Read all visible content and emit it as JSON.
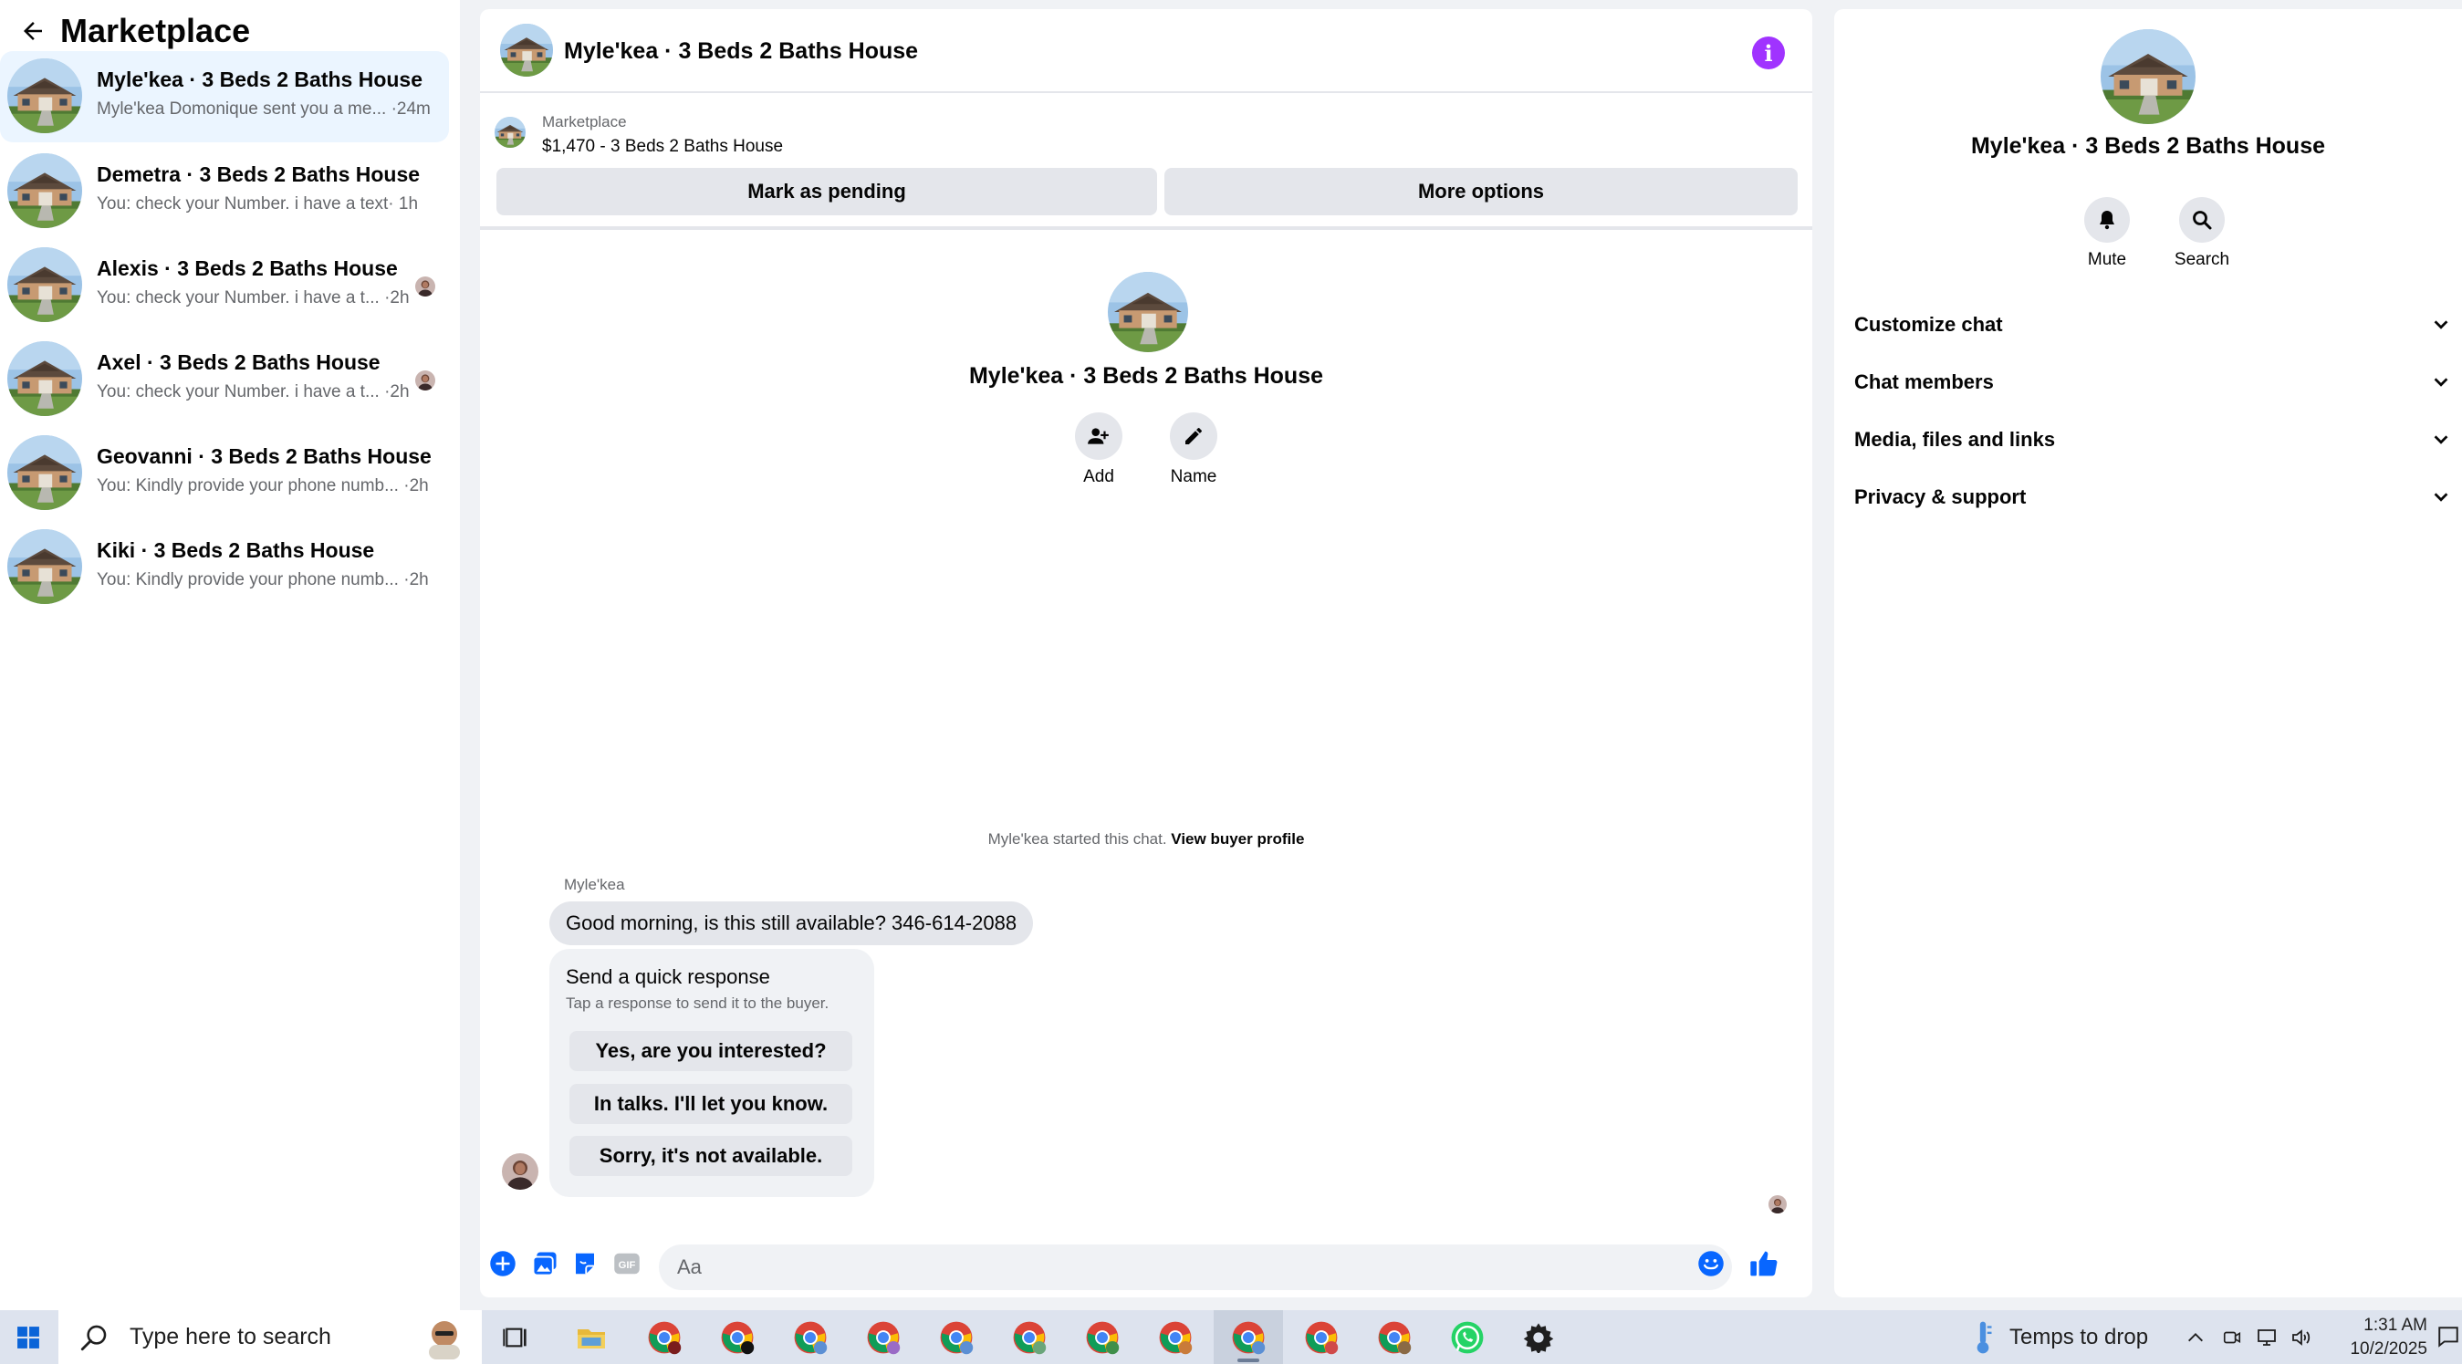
{
  "colors": {
    "accent": "#0866ff",
    "info_button": "#a033ff",
    "active_conversation": "#ebf5ff",
    "secondary_text": "#65676b",
    "button_bg": "#e4e6eb"
  },
  "sidebar": {
    "title": "Marketplace",
    "back_icon": "arrow-left-icon",
    "conversations": [
      {
        "name": "Myle'kea · 3 Beds 2 Baths House",
        "snippet": "Myle'kea Domonique sent you a me... ·24m",
        "active": true
      },
      {
        "name": "Demetra · 3 Beds 2 Baths House",
        "snippet": "You: check your Number. i have a text· 1h",
        "active": false
      },
      {
        "name": "Alexis · 3 Beds 2 Baths House",
        "snippet": "You: check your Number. i have a t... ·2h",
        "active": false
      },
      {
        "name": "Axel · 3 Beds 2 Baths House",
        "snippet": "You: check your Number. i have a t... ·2h",
        "active": false
      },
      {
        "name": "Geovanni · 3 Beds 2 Baths House",
        "snippet": "You: Kindly provide your phone numb... ·2h",
        "active": false
      },
      {
        "name": "Kiki · 3 Beds 2 Baths House",
        "snippet": "You: Kindly provide your phone numb... ·2h",
        "active": false
      }
    ]
  },
  "chat": {
    "title": "Myle'kea · 3 Beds 2 Baths House",
    "info_icon": "info-icon",
    "marketplace_label": "Marketplace",
    "listing": "$1,470 - 3 Beds 2 Baths House",
    "mark_pending_label": "Mark as pending",
    "more_options_label": "More options",
    "intro_title": "Myle'kea · 3 Beds 2 Baths House",
    "add_label": "Add",
    "name_label": "Name",
    "started_text": "Myle'kea started this chat.",
    "view_profile_label": "View buyer profile",
    "sender_name": "Myle'kea",
    "message": "Good morning, is this still available? 346-614-2088",
    "quick_response": {
      "title": "Send a quick response",
      "subtitle": "Tap a response to send it to the buyer.",
      "options": [
        "Yes, are you interested?",
        "In talks. I'll let you know.",
        "Sorry, it's not available."
      ]
    },
    "composer_placeholder": "Aa"
  },
  "info_panel": {
    "title": "Myle'kea · 3 Beds 2 Baths House",
    "mute_label": "Mute",
    "search_label": "Search",
    "sections": [
      "Customize chat",
      "Chat members",
      "Media, files and links",
      "Privacy & support"
    ]
  },
  "taskbar": {
    "search_placeholder": "Type here to search",
    "apps": [
      "task-view",
      "file-explorer",
      "chrome",
      "chrome",
      "chrome",
      "chrome",
      "chrome",
      "chrome",
      "chrome",
      "chrome",
      "chrome",
      "chrome",
      "chrome",
      "whatsapp",
      "settings"
    ],
    "weather_text": "Temps to drop",
    "time": "1:31 AM",
    "date": "10/2/2025"
  }
}
